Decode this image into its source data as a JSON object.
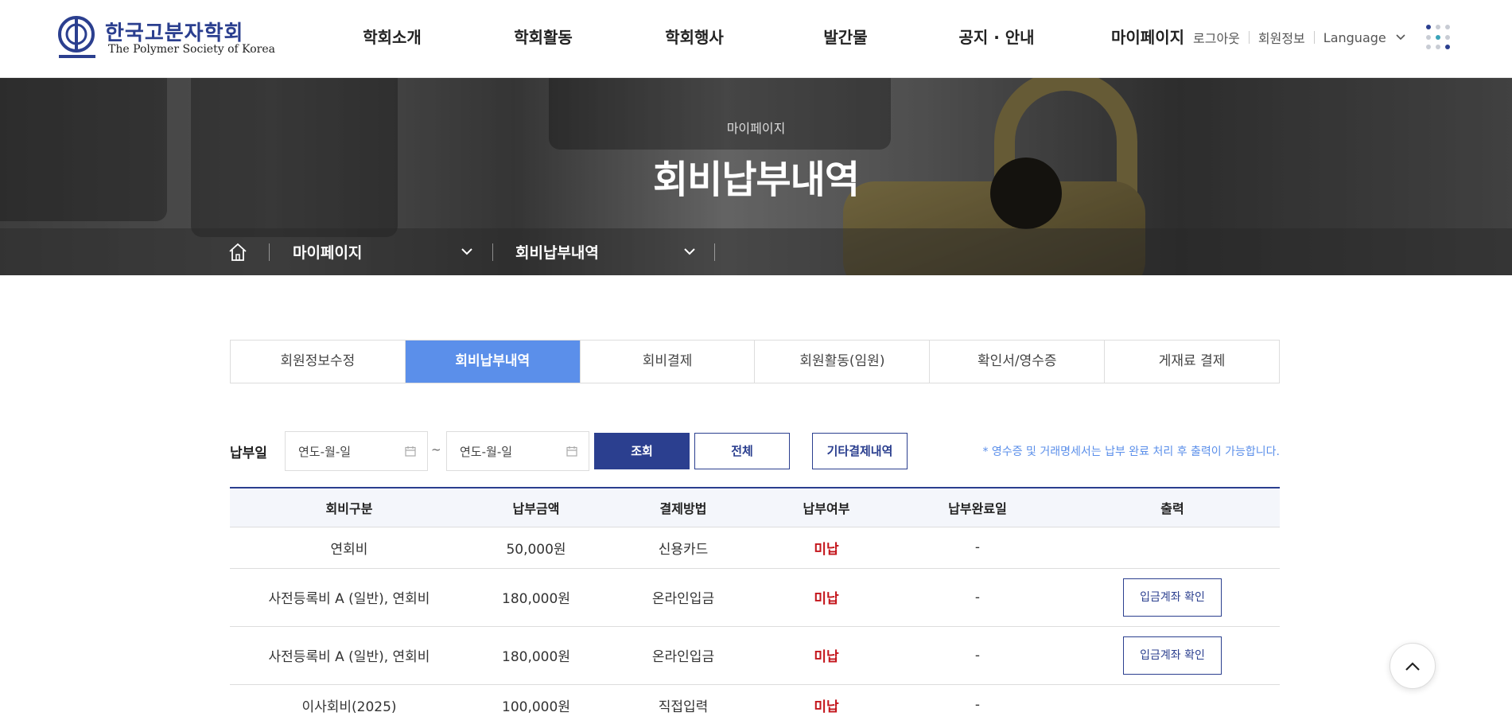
{
  "header": {
    "logo": {
      "title_kr": "한국고분자학회",
      "title_en": "The Polymer Society of Korea"
    },
    "gnb": [
      "학회소개",
      "학회활동",
      "학회행사",
      "발간물",
      "공지 · 안내",
      "마이페이지"
    ],
    "util": {
      "logout": "로그아웃",
      "member_info": "회원정보",
      "language": "Language"
    },
    "all_menu_icon": "grid-dots-icon",
    "colors": {
      "brand": "#2b3f8f",
      "dot_light": "#c8ccd4",
      "dot_teal": "#3aa3b8"
    }
  },
  "visual": {
    "subtitle": "마이페이지",
    "title": "회비납부내역",
    "location": {
      "home_icon": "home-icon",
      "depth1": "마이페이지",
      "depth2": "회비납부내역"
    }
  },
  "tabs": [
    {
      "label": "회원정보수정",
      "active": false
    },
    {
      "label": "회비납부내역",
      "active": true
    },
    {
      "label": "회비결제",
      "active": false
    },
    {
      "label": "회원활동(임원)",
      "active": false
    },
    {
      "label": "확인서/영수증",
      "active": false
    },
    {
      "label": "게재료 결제",
      "active": false
    }
  ],
  "search": {
    "label": "납부일",
    "start_placeholder": "연도-월-일",
    "end_placeholder": "연도-월-일",
    "separator": "~",
    "search_button": "조회",
    "all_button": "전체",
    "other_button": "기타결제내역",
    "notice": "* 영수증 및 거래명세서는 납부 완료 처리 후 출력이 가능합니다."
  },
  "table": {
    "headers": [
      "회비구분",
      "납부금액",
      "결제방법",
      "납부여부",
      "납부완료일",
      "출력"
    ],
    "rows": [
      {
        "type": "연회비",
        "amount": "50,000원",
        "method": "신용카드",
        "status": "미납",
        "date": "-",
        "action": ""
      },
      {
        "type": "사전등록비 A (일반), 연회비",
        "amount": "180,000원",
        "method": "온라인입금",
        "status": "미납",
        "date": "-",
        "action": "입금계좌 확인"
      },
      {
        "type": "사전등록비 A (일반), 연회비",
        "amount": "180,000원",
        "method": "온라인입금",
        "status": "미납",
        "date": "-",
        "action": "입금계좌 확인"
      },
      {
        "type": "이사회비(2025)",
        "amount": "100,000원",
        "method": "직접입력",
        "status": "미납",
        "date": "-",
        "action": ""
      }
    ]
  },
  "top_button_icon": "chevron-up-icon"
}
